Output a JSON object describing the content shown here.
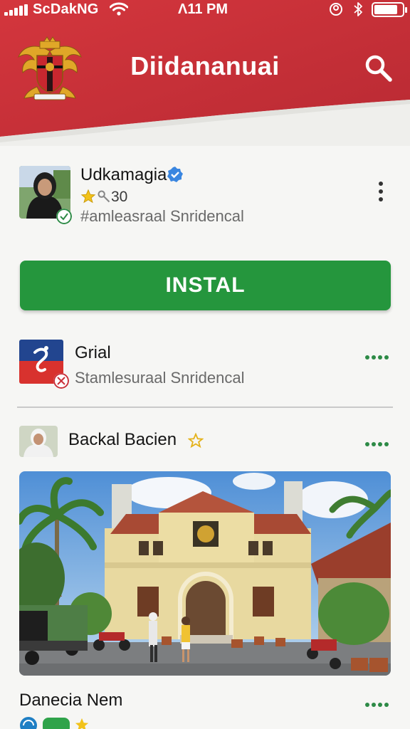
{
  "status_bar": {
    "carrier": "ScDakNG",
    "time": "Λ11 PM",
    "battery_level": 0.85
  },
  "header": {
    "title": "Diidananuai",
    "search_icon": "search-icon",
    "emblem_icon": "garuda-emblem-icon"
  },
  "post1": {
    "author": "Udkamagia",
    "verified_icon": "verified-badge-icon",
    "rating_text": "30",
    "subtitle": "#amleasraal Snridencal",
    "more_icon": "more-vertical-icon"
  },
  "install_button": {
    "label": "INSTAL"
  },
  "post2": {
    "title": "Grial",
    "subtitle": "Stamlesuraal Snridencal",
    "more_icon": "more-horizontal-icon"
  },
  "post3": {
    "author": "Backal Bacien",
    "star_icon": "star-badge-icon",
    "more_icon": "more-horizontal-icon"
  },
  "post4": {
    "author": "Danecia Nem",
    "more_icon": "more-horizontal-icon"
  },
  "colors": {
    "header_red": "#c9313a",
    "install_green": "#25963d",
    "dots_green": "#2d8a46",
    "verified_blue": "#3a86e0"
  }
}
